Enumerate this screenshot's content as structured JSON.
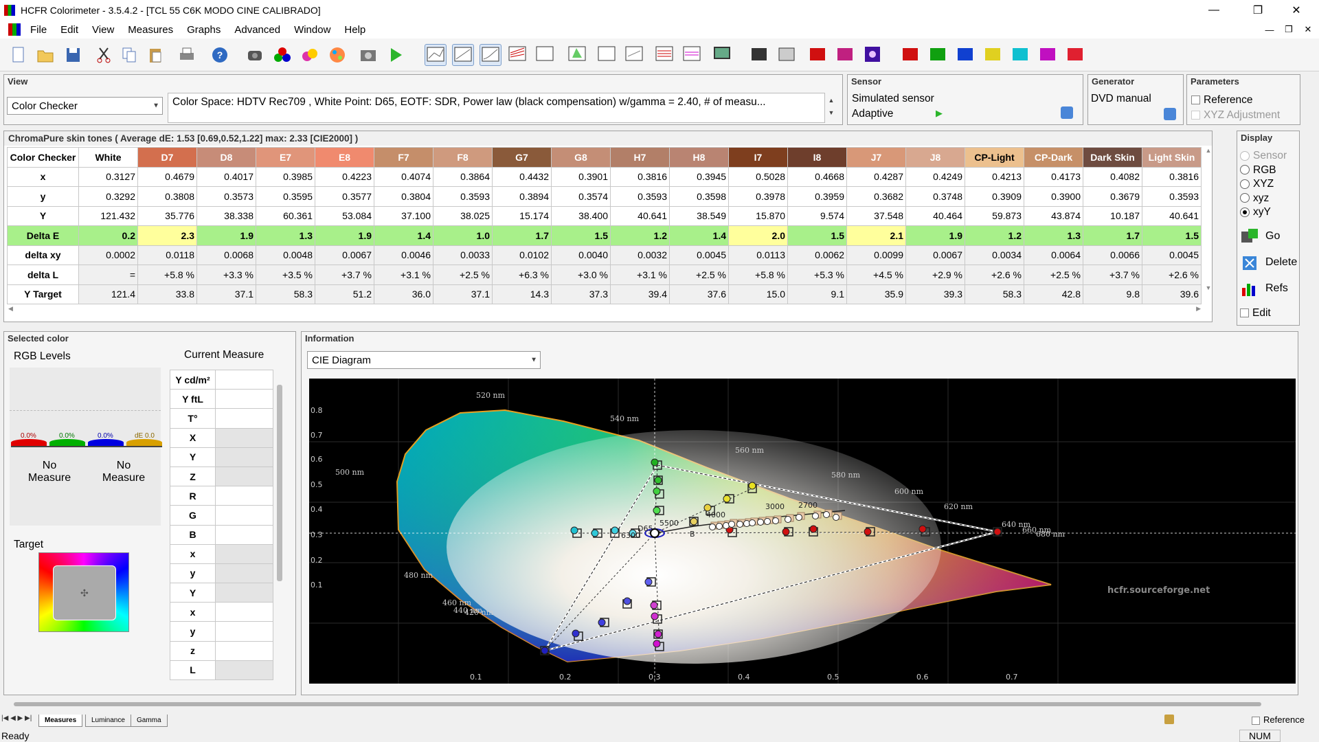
{
  "window": {
    "title": "HCFR Colorimeter - 3.5.4.2 - [TCL 55 C6K MODO CINE CALIBRADO]",
    "minimize_icon": "minimize-icon",
    "maximize_icon": "restore-icon",
    "close_icon": "close-icon"
  },
  "menu": [
    "File",
    "Edit",
    "View",
    "Measures",
    "Graphs",
    "Advanced",
    "Window",
    "Help"
  ],
  "view_panel": {
    "header": "View",
    "mode": "Color Checker",
    "info": "Color Space: HDTV Rec709 , White Point: D65, EOTF:  SDR, Power law (black compensation) w/gamma = 2.40, # of measu..."
  },
  "sensor_panel": {
    "header": "Sensor",
    "name": "Simulated sensor",
    "mode": "Adaptive"
  },
  "generator_panel": {
    "header": "Generator",
    "name": "DVD manual"
  },
  "parameters_panel": {
    "header": "Parameters",
    "reference": "Reference",
    "xyz_adjustment": "XYZ Adjustment"
  },
  "chroma_table": {
    "caption": "ChromaPure skin tones ( Average dE: 1.53 [0.69,0.52,1.22] max: 2.33 [CIE2000] )",
    "corner": "Color Checker",
    "columns": [
      {
        "label": "White",
        "bg": "#ffffff",
        "fg": "#000000"
      },
      {
        "label": "D7",
        "bg": "#d36f4e",
        "fg": "#ffffff"
      },
      {
        "label": "D8",
        "bg": "#c78c78",
        "fg": "#ffffff"
      },
      {
        "label": "E7",
        "bg": "#e0957a",
        "fg": "#ffffff"
      },
      {
        "label": "E8",
        "bg": "#f08a6e",
        "fg": "#ffffff"
      },
      {
        "label": "F7",
        "bg": "#c58e6a",
        "fg": "#ffffff"
      },
      {
        "label": "F8",
        "bg": "#cf9a7e",
        "fg": "#ffffff"
      },
      {
        "label": "G7",
        "bg": "#8a5a3a",
        "fg": "#ffffff"
      },
      {
        "label": "G8",
        "bg": "#c48e76",
        "fg": "#ffffff"
      },
      {
        "label": "H7",
        "bg": "#b27f68",
        "fg": "#ffffff"
      },
      {
        "label": "H8",
        "bg": "#b98472",
        "fg": "#ffffff"
      },
      {
        "label": "I7",
        "bg": "#7e3e1e",
        "fg": "#ffffff"
      },
      {
        "label": "I8",
        "bg": "#6e3e2c",
        "fg": "#ffffff"
      },
      {
        "label": "J7",
        "bg": "#d89878",
        "fg": "#ffffff"
      },
      {
        "label": "J8",
        "bg": "#d8a890",
        "fg": "#ffffff"
      },
      {
        "label": "CP-Light",
        "bg": "#ecc08e",
        "fg": "#000000"
      },
      {
        "label": "CP-Dark",
        "bg": "#c69068",
        "fg": "#ffffff"
      },
      {
        "label": "Dark Skin",
        "bg": "#6e4c40",
        "fg": "#ffffff"
      },
      {
        "label": "Light Skin",
        "bg": "#c89a88",
        "fg": "#ffffff"
      }
    ],
    "rows": [
      {
        "label": "x",
        "values": [
          "0.3127",
          "0.4679",
          "0.4017",
          "0.3985",
          "0.4223",
          "0.4074",
          "0.3864",
          "0.4432",
          "0.3901",
          "0.3816",
          "0.3945",
          "0.5028",
          "0.4668",
          "0.4287",
          "0.4249",
          "0.4213",
          "0.4173",
          "0.4082",
          "0.3816"
        ]
      },
      {
        "label": "y",
        "values": [
          "0.3292",
          "0.3808",
          "0.3573",
          "0.3595",
          "0.3577",
          "0.3804",
          "0.3593",
          "0.3894",
          "0.3574",
          "0.3593",
          "0.3598",
          "0.3978",
          "0.3959",
          "0.3682",
          "0.3748",
          "0.3909",
          "0.3900",
          "0.3679",
          "0.3593"
        ]
      },
      {
        "label": "Y",
        "values": [
          "121.432",
          "35.776",
          "38.338",
          "60.361",
          "53.084",
          "37.100",
          "38.025",
          "15.174",
          "38.400",
          "40.641",
          "38.549",
          "15.870",
          "9.574",
          "37.548",
          "40.464",
          "59.873",
          "43.874",
          "10.187",
          "40.641"
        ]
      },
      {
        "label": "Delta E",
        "values": [
          "0.2",
          "2.3",
          "1.9",
          "1.3",
          "1.9",
          "1.4",
          "1.0",
          "1.7",
          "1.5",
          "1.2",
          "1.4",
          "2.0",
          "1.5",
          "2.1",
          "1.9",
          "1.2",
          "1.3",
          "1.7",
          "1.5"
        ]
      },
      {
        "label": "delta xy",
        "values": [
          "0.0002",
          "0.0118",
          "0.0068",
          "0.0048",
          "0.0067",
          "0.0046",
          "0.0033",
          "0.0102",
          "0.0040",
          "0.0032",
          "0.0045",
          "0.0113",
          "0.0062",
          "0.0099",
          "0.0067",
          "0.0034",
          "0.0064",
          "0.0066",
          "0.0045"
        ]
      },
      {
        "label": "delta L",
        "values": [
          "=",
          "+5.8 %",
          "+3.3 %",
          "+3.5 %",
          "+3.7 %",
          "+3.1 %",
          "+2.5 %",
          "+6.3 %",
          "+3.0 %",
          "+3.1 %",
          "+2.5 %",
          "+5.8 %",
          "+5.3 %",
          "+4.5 %",
          "+2.9 %",
          "+2.6 %",
          "+2.5 %",
          "+3.7 %",
          "+2.6 %"
        ]
      },
      {
        "label": "Y Target",
        "values": [
          "121.4",
          "33.8",
          "37.1",
          "58.3",
          "51.2",
          "36.0",
          "37.1",
          "14.3",
          "37.3",
          "39.4",
          "37.6",
          "15.0",
          "9.1",
          "35.9",
          "39.3",
          "58.3",
          "42.8",
          "9.8",
          "39.6"
        ]
      }
    ],
    "delta_e_colors": {
      "good": "#a8f08a",
      "warn": "#ffff9c"
    }
  },
  "display_panel": {
    "header": "Display",
    "options": [
      "Sensor",
      "RGB",
      "XYZ",
      "xyz",
      "xyY"
    ],
    "selected": "xyY",
    "go": "Go",
    "delete": "Delete",
    "refs": "Refs",
    "edit": "Edit"
  },
  "selected_color": {
    "header": "Selected color",
    "rgb_levels": "RGB Levels",
    "current_measure": "Current Measure",
    "bars": [
      {
        "label": "0.0%",
        "color": "#e00000"
      },
      {
        "label": "0.0%",
        "color": "#00b000"
      },
      {
        "label": "0.0%",
        "color": "#0000e0"
      },
      {
        "label": "dE 0.0",
        "color": "#d8a000"
      }
    ],
    "no_measure_1": "No\nMeasure",
    "no_measure_2": "No\nMeasure",
    "target": "Target",
    "measure_rows": [
      "Y cd/m²",
      "Y ftL",
      "T°",
      "X",
      "Y",
      "Z",
      "R",
      "G",
      "B",
      "x",
      "y",
      "Y",
      "x",
      "y",
      "z",
      "L"
    ]
  },
  "information": {
    "header": "Information",
    "view": "CIE Diagram",
    "watermark": "hcfr.sourceforge.net",
    "x_ticks": [
      "0.1",
      "0.2",
      "0.3",
      "0.4",
      "0.5",
      "0.6",
      "0.7"
    ],
    "y_ticks": [
      "0.1",
      "0.2",
      "0.3",
      "0.4",
      "0.5",
      "0.6",
      "0.7",
      "0.8"
    ],
    "wavelengths": [
      "520 nm",
      "540 nm",
      "560 nm",
      "580 nm",
      "600 nm",
      "620 nm",
      "640 nm",
      "660 nm",
      "680 nm",
      "500 nm",
      "480 nm",
      "460 nm",
      "440 nm",
      "420 nm"
    ],
    "cct_labels": [
      "5500",
      "4000",
      "3000",
      "2700",
      "D65",
      "B",
      "6300"
    ]
  },
  "bottom_tabs": [
    "Measures",
    "Luminance",
    "Gamma"
  ],
  "status": {
    "text": "Ready",
    "num": "NUM",
    "reference": "Reference"
  }
}
